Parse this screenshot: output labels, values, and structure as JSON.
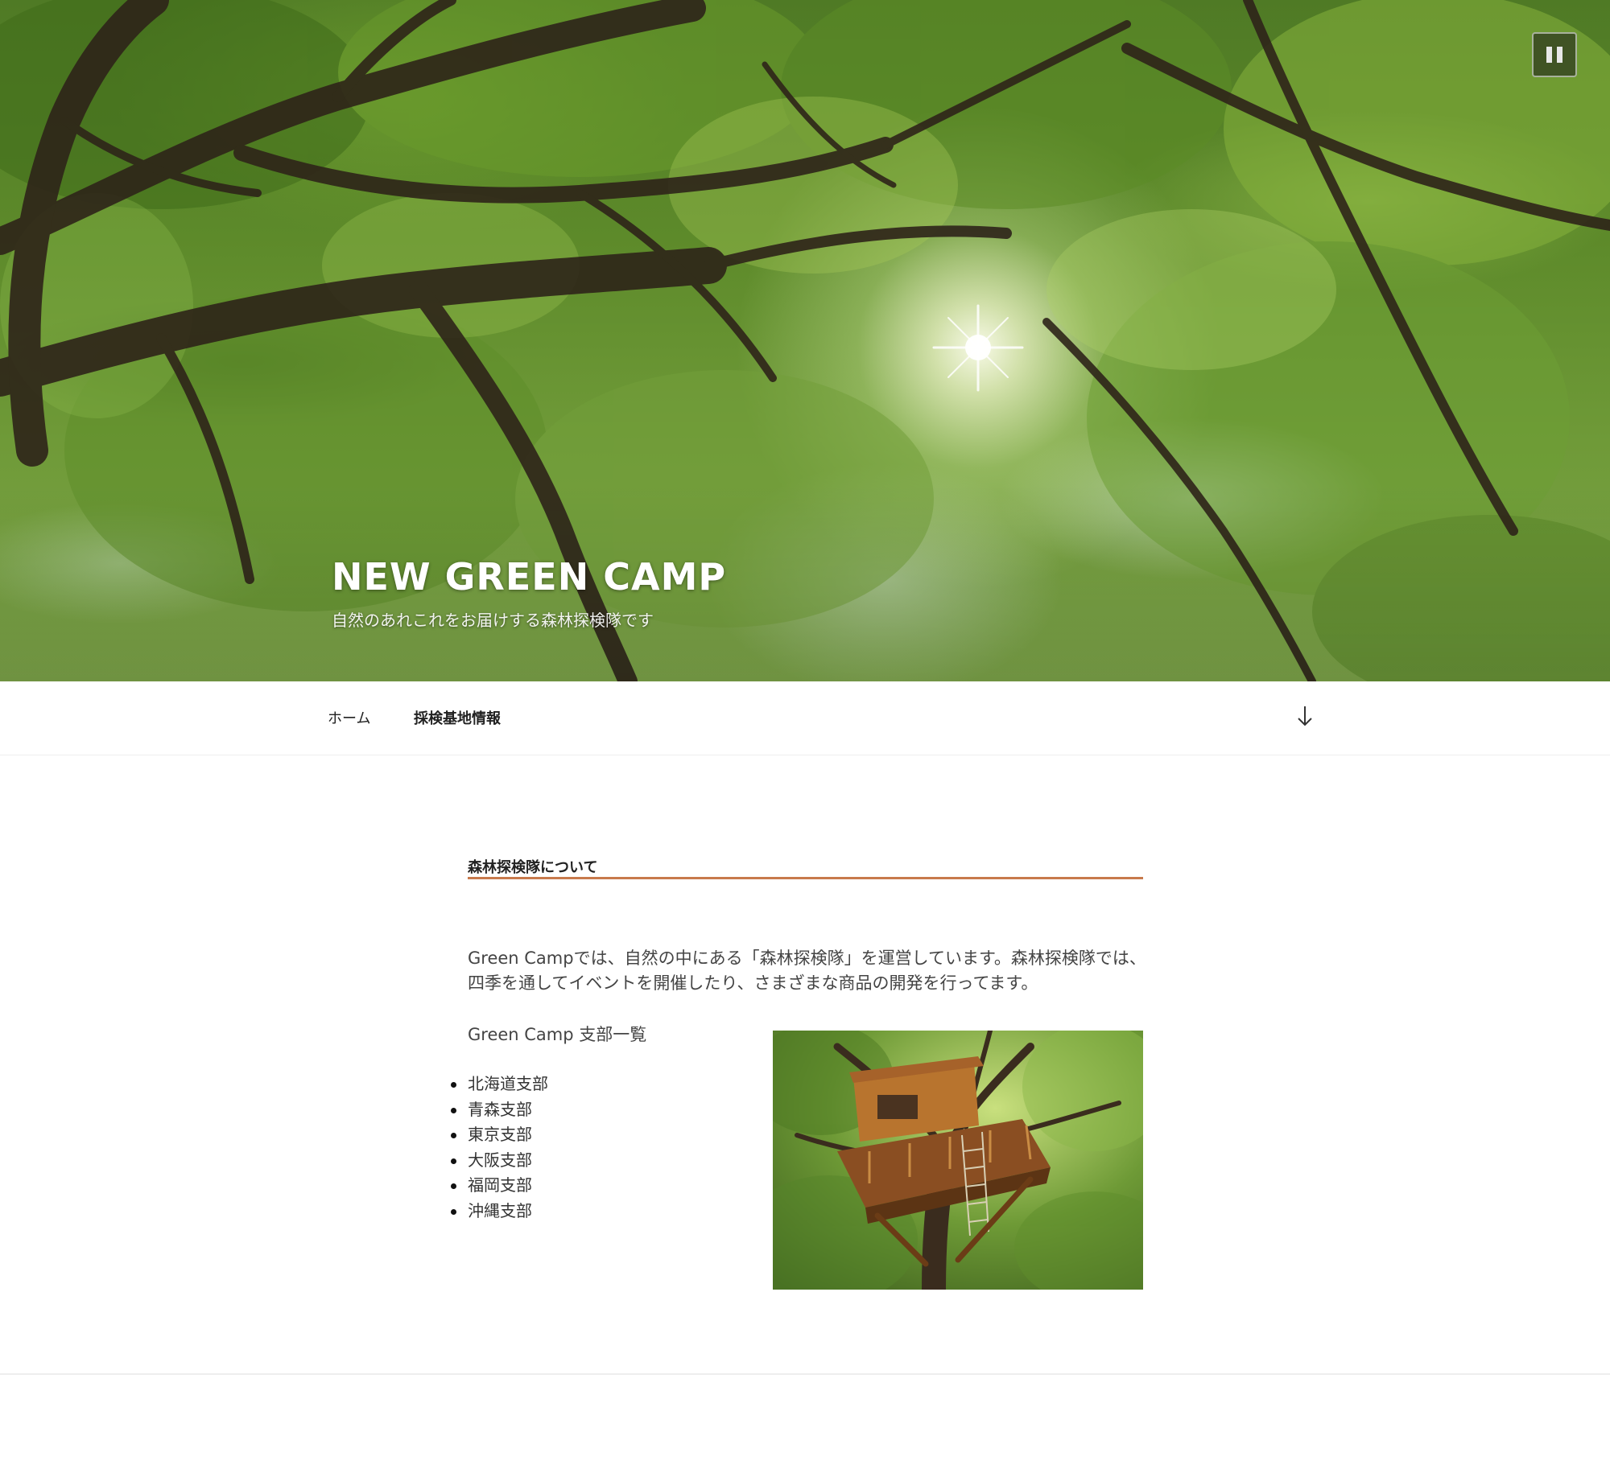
{
  "header": {
    "site_title": "NEW GREEN CAMP",
    "tagline": "自然のあれこれをお届けする森林探検隊です",
    "pause_button_icon": "pause-icon"
  },
  "nav": {
    "items": [
      {
        "label": "ホーム"
      },
      {
        "label": "採検基地情報"
      }
    ],
    "scroll_icon": "arrow-down-icon"
  },
  "main": {
    "section_title": "森林探検隊について",
    "intro": "Green Campでは、自然の中にある「森林探検隊」を運営しています。森林探検隊では、四季を通してイベントを開催したり、さまざまな商品の開発を行ってます。",
    "branch_heading": "Green Camp 支部一覧",
    "branches": [
      "北海道支部",
      "青森支部",
      "東京支部",
      "大阪支部",
      "福岡支部",
      "沖縄支部"
    ]
  },
  "colors": {
    "accent_rule": "#c87a4c",
    "text": "#333333",
    "background": "#ffffff"
  }
}
